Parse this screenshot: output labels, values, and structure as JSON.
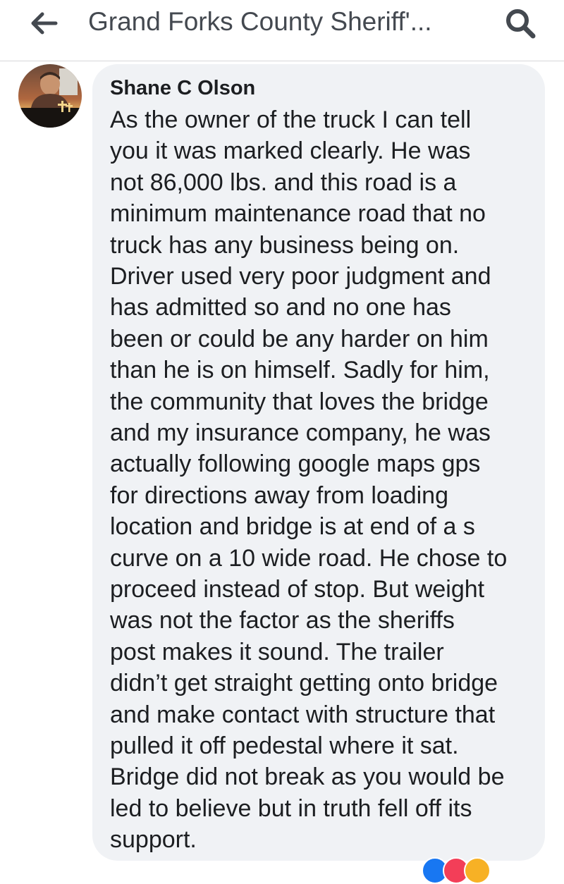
{
  "header": {
    "title": "Grand Forks County Sheriff'...",
    "back_icon": "arrow-left-icon",
    "search_icon": "search-icon"
  },
  "comment": {
    "author": "Shane C Olson",
    "avatar_text": "Christ is Risen!",
    "lines": [
      "As the owner of the truck I can tell",
      "you it was marked clearly. He was",
      "not 86,000 lbs. and this road is a",
      "minimum maintenance road that no",
      "truck has any business being on.",
      "Driver used very poor judgment and",
      "has admitted so and no one has",
      "been or could be any harder on him",
      "than he is on himself. Sadly for him,",
      "the community that loves the bridge",
      "and my insurance company, he was",
      "actually following google maps gps",
      "for directions away from loading",
      "location and bridge is at end of a s",
      "curve on a 10 wide road. He chose to",
      "proceed instead of stop. But weight",
      "was not the factor as the sheriffs",
      "post makes it sound. The trailer",
      "didn’t get straight getting onto bridge",
      "and make contact with structure that",
      "pulled it off pedestal where it sat.",
      "Bridge did not break as you would be",
      "led to believe but in truth fell off its",
      "support."
    ]
  },
  "colors": {
    "bubble_bg": "#f0f2f5",
    "text": "#1c1e21",
    "header_text": "#444950",
    "reaction_like": "#1877f2",
    "reaction_love": "#f33e58",
    "reaction_haha": "#f7b125"
  }
}
